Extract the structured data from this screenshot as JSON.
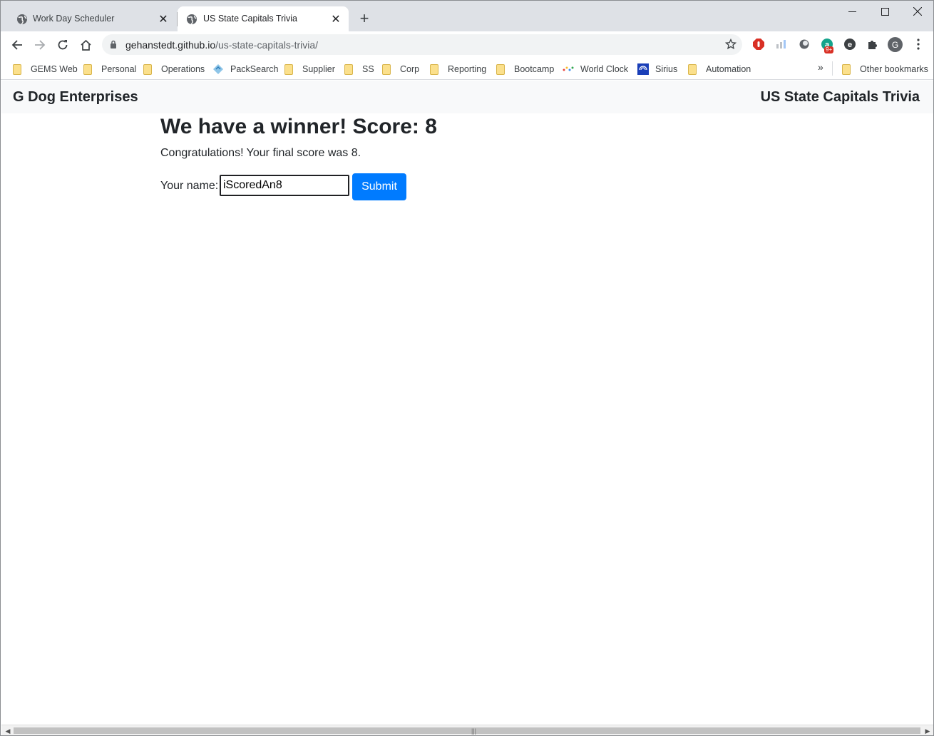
{
  "tabs": [
    {
      "title": "Work Day Scheduler",
      "icon": "globe-icon",
      "active": false
    },
    {
      "title": "US State Capitals Trivia",
      "icon": "globe-icon",
      "active": true
    }
  ],
  "address_bar": {
    "host": "gehanstedt.github.io",
    "path": "/us-state-capitals-trivia/"
  },
  "extension_badge": "9+",
  "profile_initial": "G",
  "bookmarks": [
    {
      "label": "GEMS Web",
      "icon": "folder-icon"
    },
    {
      "label": "Personal",
      "icon": "folder-icon"
    },
    {
      "label": "Operations",
      "icon": "folder-icon"
    },
    {
      "label": "PackSearch",
      "icon": "packsearch-icon"
    },
    {
      "label": "Supplier",
      "icon": "folder-icon"
    },
    {
      "label": "SS",
      "icon": "folder-icon"
    },
    {
      "label": "Corp",
      "icon": "folder-icon"
    },
    {
      "label": "Reporting",
      "icon": "folder-icon"
    },
    {
      "label": "Bootcamp",
      "icon": "folder-icon"
    },
    {
      "label": "World Clock",
      "icon": "world-clock-icon"
    },
    {
      "label": "Sirius",
      "icon": "sirius-icon"
    },
    {
      "label": "Automation",
      "icon": "folder-icon"
    }
  ],
  "other_bookmarks": "Other bookmarks",
  "page": {
    "brand": "G Dog Enterprises",
    "nav_title": "US State Capitals Trivia",
    "headline": "We have a winner! Score: 8",
    "congrats": "Congratulations! Your final score was 8.",
    "name_label": "Your name:",
    "name_value": "iScoredAn8",
    "submit_label": "Submit"
  },
  "colors": {
    "primary_button": "#007bff",
    "navbar_bg": "#f8f9fa",
    "tabstrip_bg": "#dee1e6"
  }
}
